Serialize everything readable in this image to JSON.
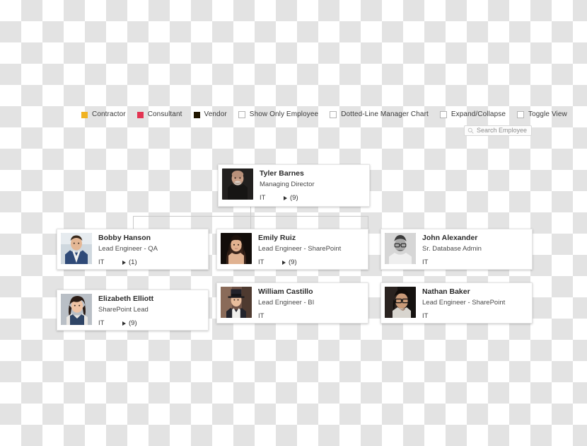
{
  "toolbar": {
    "legend": [
      {
        "name": "contractor",
        "label": "Contractor",
        "color": "#f0b323"
      },
      {
        "name": "consultant",
        "label": "Consultant",
        "color": "#e23452"
      },
      {
        "name": "vendor",
        "label": "Vendor",
        "color": "#201600"
      }
    ],
    "checkboxes": [
      {
        "name": "show-only-employee",
        "label": "Show Only Employee",
        "checked": false
      },
      {
        "name": "dotted-line-manager-chart",
        "label": "Dotted-Line Manager Chart",
        "checked": false
      },
      {
        "name": "expand-collapse",
        "label": "Expand/Collapse",
        "checked": false
      },
      {
        "name": "toggle-view",
        "label": "Toggle View",
        "checked": false
      }
    ]
  },
  "search": {
    "placeholder": "Search Employee",
    "value": "",
    "icon": "search-icon"
  },
  "chart": {
    "root": {
      "name": "Tyler Barnes",
      "title": "Managing Director",
      "department": "IT",
      "count": "(9)",
      "has_expand": true,
      "avatar": "photo-man-bald-dark"
    },
    "columns": [
      {
        "name": "left-column",
        "cards": [
          {
            "name": "Bobby Hanson",
            "title": "Lead Engineer - QA",
            "department": "IT",
            "count": "(1)",
            "has_expand": true,
            "avatar": "photo-man-blue-sweater"
          },
          {
            "name": "Elizabeth Elliott",
            "title": "SharePoint Lead",
            "department": "IT",
            "count": "(9)",
            "has_expand": true,
            "avatar": "photo-woman-dark-hair"
          }
        ]
      },
      {
        "name": "middle-column",
        "cards": [
          {
            "name": "Emily Ruiz",
            "title": "Lead Engineer - SharePoint",
            "department": "IT",
            "count": "(9)",
            "has_expand": true,
            "avatar": "photo-woman-long-hair"
          },
          {
            "name": "William Castillo",
            "title": "Lead Engineer - BI",
            "department": "IT",
            "count": "",
            "has_expand": false,
            "avatar": "photo-man-hat"
          }
        ]
      },
      {
        "name": "right-column",
        "cards": [
          {
            "name": "John Alexander",
            "title": "Sr. Database Admin",
            "department": "IT",
            "count": "",
            "has_expand": false,
            "avatar": "photo-man-glasses-gray"
          },
          {
            "name": "Nathan Baker",
            "title": "Lead Engineer - SharePoint",
            "department": "IT",
            "count": "",
            "has_expand": false,
            "avatar": "photo-man-glasses-dark"
          }
        ]
      }
    ]
  }
}
